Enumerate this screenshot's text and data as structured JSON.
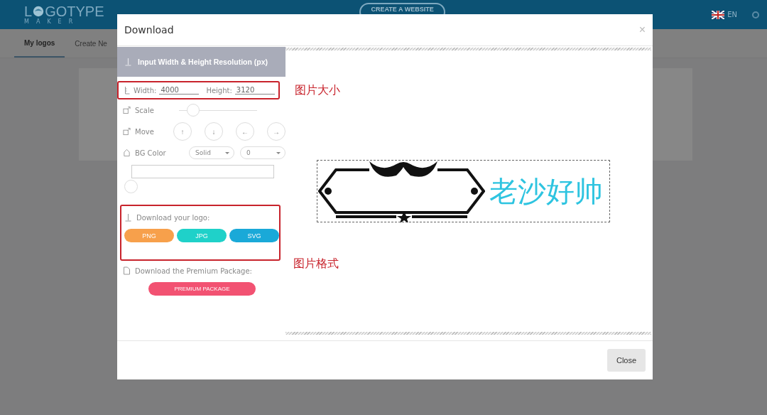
{
  "header": {
    "logo": {
      "prefix": "L",
      "suffix": "GOTYPE",
      "subtitle": "MAKER"
    },
    "create_button": "CREATE A WEBSITE",
    "language": "EN"
  },
  "tabs": [
    {
      "label": "My logos",
      "selected": true
    },
    {
      "label": "Create Ne",
      "selected": false
    }
  ],
  "dialog": {
    "title": "Download",
    "close_icon": "×",
    "section_header": "Input Width & Height Resolution (px)",
    "width": {
      "label": "Width:",
      "value": "4000"
    },
    "height": {
      "label": "Height:",
      "value": "3120"
    },
    "scale": {
      "label": "Scale",
      "level": 0.1
    },
    "move": {
      "label": "Move",
      "buttons": [
        "↑",
        "↓",
        "←",
        "→"
      ]
    },
    "bg_color": {
      "label": "BG Color",
      "selects": [
        "Solid",
        "0"
      ]
    },
    "download_label": "Download your logo:",
    "formats": [
      {
        "label": "PNG",
        "color": "#f7a04b"
      },
      {
        "label": "JPG",
        "color": "#1fd1c9"
      },
      {
        "label": "SVG",
        "color": "#1aa9d8"
      }
    ],
    "premium_label": "Download the Premium Package:",
    "premium_button": "PREMIUM PACKAGE",
    "preview_text": "老沙好帅",
    "close_button": "Close"
  },
  "annotations": [
    {
      "text": "图片大小"
    },
    {
      "text": "图片格式"
    }
  ]
}
